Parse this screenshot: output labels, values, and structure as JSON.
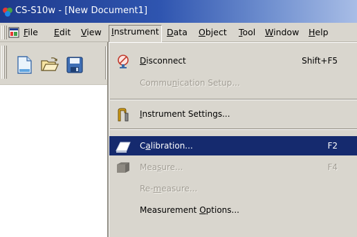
{
  "window": {
    "title": "CS-S10w - [New Document1]"
  },
  "menubar": {
    "items": [
      {
        "label": "File",
        "accel": "F"
      },
      {
        "label": "Edit",
        "accel": "E"
      },
      {
        "label": "View",
        "accel": "V"
      },
      {
        "label": "Instrument",
        "accel": "I"
      },
      {
        "label": "Data",
        "accel": "D"
      },
      {
        "label": "Object",
        "accel": "O"
      },
      {
        "label": "Tool",
        "accel": "T"
      },
      {
        "label": "Window",
        "accel": "W"
      },
      {
        "label": "Help",
        "accel": "H"
      }
    ],
    "active": "Instrument"
  },
  "toolbar": {
    "buttons": [
      {
        "icon": "new-document-icon"
      },
      {
        "icon": "open-folder-icon"
      },
      {
        "icon": "save-disk-icon"
      }
    ]
  },
  "dropdown": {
    "items": [
      {
        "pre": "",
        "acc": "D",
        "post": "isconnect",
        "shortcut": "Shift+F5",
        "icon": "disconnect-icon",
        "state": "enabled"
      },
      {
        "pre": "Commu",
        "acc": "n",
        "post": "ication Setup...",
        "shortcut": "",
        "icon": "",
        "state": "disabled"
      },
      {
        "pre": "",
        "acc": "I",
        "post": "nstrument Settings...",
        "shortcut": "",
        "icon": "instrument-settings-icon",
        "state": "enabled"
      },
      {
        "pre": "C",
        "acc": "a",
        "post": "libration...",
        "shortcut": "F2",
        "icon": "calibration-icon",
        "state": "selected"
      },
      {
        "pre": "Mea",
        "acc": "s",
        "post": "ure...",
        "shortcut": "F4",
        "icon": "measure-icon",
        "state": "disabled"
      },
      {
        "pre": "Re-",
        "acc": "m",
        "post": "easure...",
        "shortcut": "",
        "icon": "",
        "state": "disabled"
      },
      {
        "pre": "Measurement ",
        "acc": "O",
        "post": "ptions...",
        "shortcut": "",
        "icon": "",
        "state": "enabled"
      }
    ]
  },
  "colors": {
    "titlebar_start": "#1e3a8c",
    "menu_bg": "#d9d6ce",
    "highlight": "#152a6e",
    "disabled_text": "#a19d94"
  }
}
